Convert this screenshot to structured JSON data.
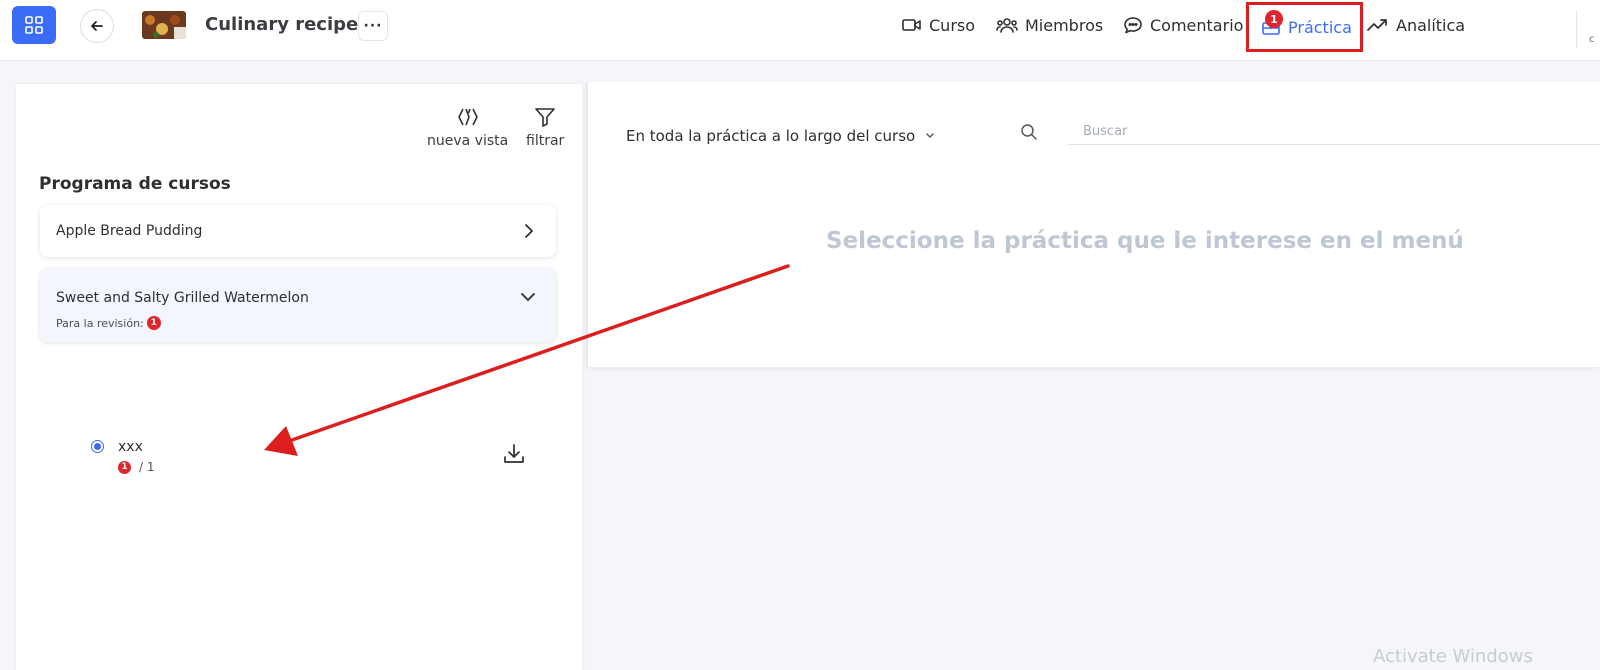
{
  "header": {
    "course_title": "Culinary recipes",
    "more_label": "···",
    "nav": {
      "curso": "Curso",
      "miembros": "Miembros",
      "comentario": "Comentario",
      "practica": "Práctica",
      "practica_badge": "1",
      "analitica": "Analítica"
    },
    "right_stub": "c"
  },
  "left": {
    "tools": {
      "nueva_vista": "nueva vista",
      "filtrar": "filtrar"
    },
    "section_title": "Programa de cursos",
    "courses": [
      {
        "title": "Apple Bread Pudding"
      },
      {
        "title": "Sweet and Salty Grilled Watermelon",
        "review_label": "Para la revisión:",
        "review_count": "1"
      }
    ],
    "practice_item": {
      "name": "xxx",
      "pending": "1",
      "total": "/ 1"
    }
  },
  "right": {
    "scope_label": "En toda la práctica a lo largo del curso",
    "search_placeholder": "Buscar",
    "empty_message": "Seleccione la práctica que le interese en el menú"
  },
  "watermark": "Activate Windows",
  "colors": {
    "accent": "#3b6cf6",
    "badge": "#e0262c",
    "annotation": "#dc1e1e",
    "empty_text": "#bfc6d4"
  }
}
